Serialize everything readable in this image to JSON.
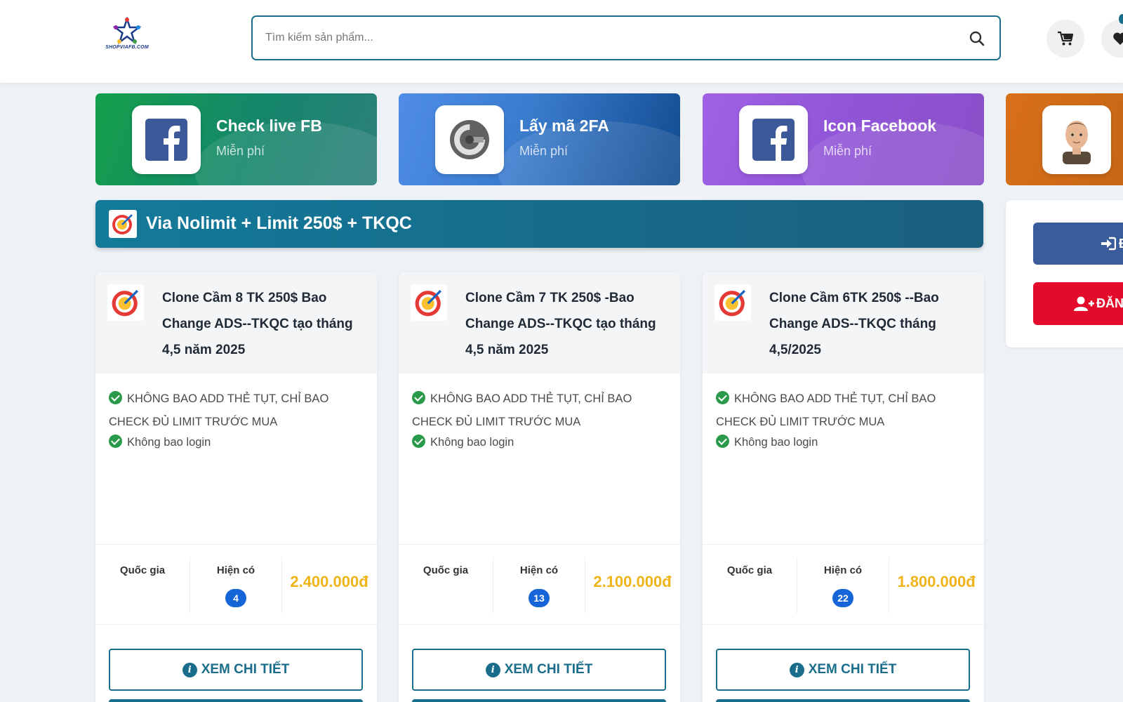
{
  "header": {
    "logo_text": "SHOPVIAFB.COM",
    "search": {
      "placeholder": "Tìm kiếm sản phẩm..."
    }
  },
  "tools": [
    {
      "title": "Check live FB",
      "subtitle": "Miễn phí",
      "icon": "facebook-icon"
    },
    {
      "title": "Lấy mã 2FA",
      "subtitle": "Miễn phí",
      "icon": "google-authenticator-icon"
    },
    {
      "title": "Icon Facebook",
      "subtitle": "Miễn phí",
      "icon": "facebook-icon"
    },
    {
      "title": "",
      "subtitle": "",
      "icon": "avatar-icon"
    }
  ],
  "category": {
    "title": "Via Nolimit + Limit 250$ + TKQC",
    "icon": "ads-target-icon"
  },
  "products": [
    {
      "title": "Clone Cầm 8 TK 250$ Bao Change ADS--TKQC tạo tháng 4,5 năm 2025",
      "features": [
        "KHÔNG BAO ADD THẺ TỤT, CHỈ BAO CHECK ĐỦ LIMIT TRƯỚC MUA",
        "Không bao login"
      ],
      "country_label": "Quốc gia",
      "stock_label": "Hiện có",
      "stock": "4",
      "price": "2.400.000đ",
      "detail_label": "XEM CHI TIẾT"
    },
    {
      "title": "Clone Cầm 7 TK 250$ -Bao Change ADS--TKQC tạo tháng 4,5 năm 2025",
      "features": [
        "KHÔNG BAO ADD THẺ TỤT, CHỈ BAO CHECK ĐỦ LIMIT TRƯỚC MUA",
        "Không bao login"
      ],
      "country_label": "Quốc gia",
      "stock_label": "Hiện có",
      "stock": "13",
      "price": "2.100.000đ",
      "detail_label": "XEM CHI TIẾT"
    },
    {
      "title": "Clone Cầm 6TK 250$ --Bao Change ADS--TKQC tháng 4,5/2025",
      "features": [
        "KHÔNG BAO ADD THẺ TỤT, CHỈ BAO CHECK ĐỦ LIMIT TRƯỚC MUA",
        "Không bao login"
      ],
      "country_label": "Quốc gia",
      "stock_label": "Hiện có",
      "stock": "22",
      "price": "1.800.000đ",
      "detail_label": "XEM CHI TIẾT"
    }
  ],
  "auth": {
    "login_label": "Đ",
    "register_label": "ĐĂNG"
  },
  "colors": {
    "accent": "#1a6e8c",
    "price": "#f0b41a",
    "badge": "#1565d8",
    "register": "#e30a2a",
    "login": "#3a5c9a"
  }
}
